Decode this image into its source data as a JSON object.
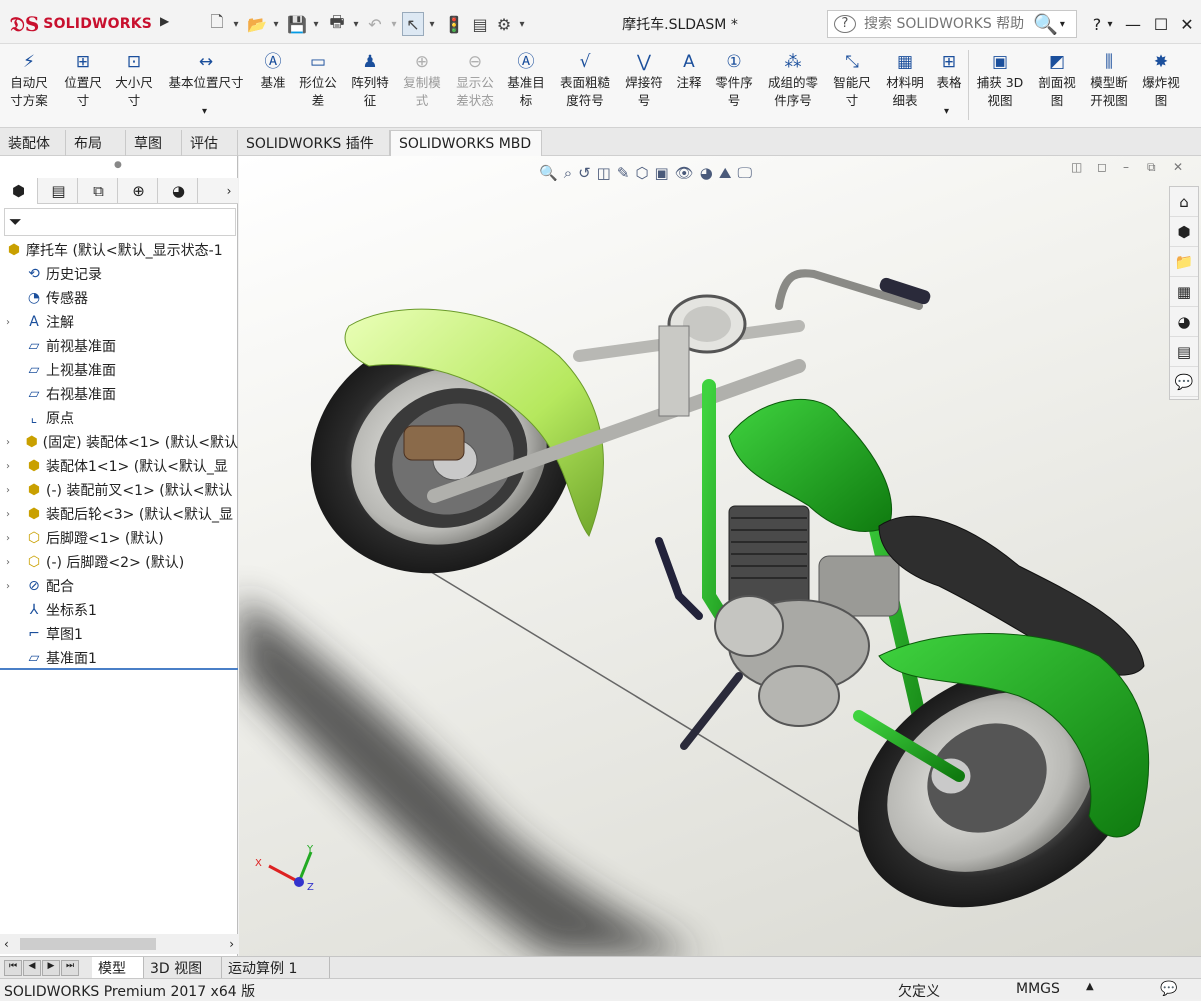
{
  "app": {
    "logo_text": "SOLIDWORKS",
    "doc_title": "摩托车.SLDASM *",
    "search_placeholder": "搜索 SOLIDWORKS 帮助",
    "help_label": "?"
  },
  "command_manager": {
    "buttons": [
      {
        "label": "自动尺\n寸方案",
        "icon": "auto-dimension-icon"
      },
      {
        "label": "位置尺\n寸",
        "icon": "location-dimension-icon"
      },
      {
        "label": "大小尺\n寸",
        "icon": "size-dimension-icon"
      },
      {
        "label": "基本位置尺寸",
        "icon": "basic-location-dimension-icon"
      },
      {
        "label": "基准",
        "icon": "datum-icon"
      },
      {
        "label": "形位公\n差",
        "icon": "geometric-tolerance-icon"
      },
      {
        "label": "阵列特\n征",
        "icon": "pattern-feature-icon"
      },
      {
        "label": "复制模\n式",
        "icon": "copy-scheme-icon",
        "disabled": true
      },
      {
        "label": "显示公\n差状态",
        "icon": "show-tolerance-status-icon",
        "disabled": true
      },
      {
        "label": "基准目\n标",
        "icon": "datum-target-icon"
      },
      {
        "label": "表面粗糙\n度符号",
        "icon": "surface-finish-icon"
      },
      {
        "label": "焊接符\n号",
        "icon": "weld-symbol-icon"
      },
      {
        "label": "注释",
        "icon": "note-icon"
      },
      {
        "label": "零件序\n号",
        "icon": "balloon-icon"
      },
      {
        "label": "成组的零\n件序号",
        "icon": "stacked-balloon-icon"
      },
      {
        "label": "智能尺\n寸",
        "icon": "smart-dimension-icon"
      },
      {
        "label": "材料明\n细表",
        "icon": "bom-icon"
      },
      {
        "label": "表格",
        "icon": "table-icon"
      },
      {
        "label": "捕获 3D\n视图",
        "icon": "capture-3d-view-icon"
      },
      {
        "label": "剖面视\n图",
        "icon": "section-view-icon"
      },
      {
        "label": "模型断\n开视图",
        "icon": "model-break-view-icon"
      },
      {
        "label": "爆炸视\n图",
        "icon": "exploded-view-icon"
      }
    ]
  },
  "tabs": [
    "装配体",
    "布局",
    "草图",
    "评估",
    "SOLIDWORKS 插件",
    "SOLIDWORKS MBD"
  ],
  "active_tab": "SOLIDWORKS MBD",
  "feature_tree": {
    "root": "摩托车 (默认<默认_显示状态-1",
    "items": [
      {
        "label": "历史记录",
        "icon": "history-icon",
        "expandable": false
      },
      {
        "label": "传感器",
        "icon": "sensor-icon",
        "expandable": false
      },
      {
        "label": "注解",
        "icon": "annotations-icon",
        "expandable": true
      },
      {
        "label": "前视基准面",
        "icon": "plane-icon",
        "expandable": false
      },
      {
        "label": "上视基准面",
        "icon": "plane-icon",
        "expandable": false
      },
      {
        "label": "右视基准面",
        "icon": "plane-icon",
        "expandable": false
      },
      {
        "label": "原点",
        "icon": "origin-icon",
        "expandable": false
      },
      {
        "label": "(固定) 装配体<1> (默认<默认",
        "icon": "subassembly-icon",
        "expandable": true
      },
      {
        "label": "装配体1<1> (默认<默认_显",
        "icon": "subassembly-icon",
        "expandable": true
      },
      {
        "label": "(-) 装配前叉<1> (默认<默认",
        "icon": "subassembly-icon",
        "expandable": true
      },
      {
        "label": "装配后轮<3> (默认<默认_显",
        "icon": "subassembly-icon",
        "expandable": true
      },
      {
        "label": "后脚蹬<1> (默认)",
        "icon": "part-icon",
        "expandable": true
      },
      {
        "label": "(-) 后脚蹬<2> (默认)",
        "icon": "part-icon",
        "expandable": true
      },
      {
        "label": "配合",
        "icon": "mates-icon",
        "expandable": true
      },
      {
        "label": "坐标系1",
        "icon": "coordinate-system-icon",
        "expandable": false
      },
      {
        "label": "草图1",
        "icon": "sketch-icon",
        "expandable": false
      },
      {
        "label": "基准面1",
        "icon": "plane-icon",
        "expandable": false
      }
    ]
  },
  "bottom_tabs": [
    "模型",
    "3D 视图",
    "运动算例 1"
  ],
  "status": {
    "product": "SOLIDWORKS Premium 2017 x64 版",
    "definition": "欠定义",
    "units": "MMGS"
  },
  "triad": {
    "x": "X",
    "y": "Y",
    "z": "Z"
  },
  "colors": {
    "brand": "#c8102e",
    "body_green": "#1aa51a",
    "fender_lime": "#c6f07a"
  }
}
